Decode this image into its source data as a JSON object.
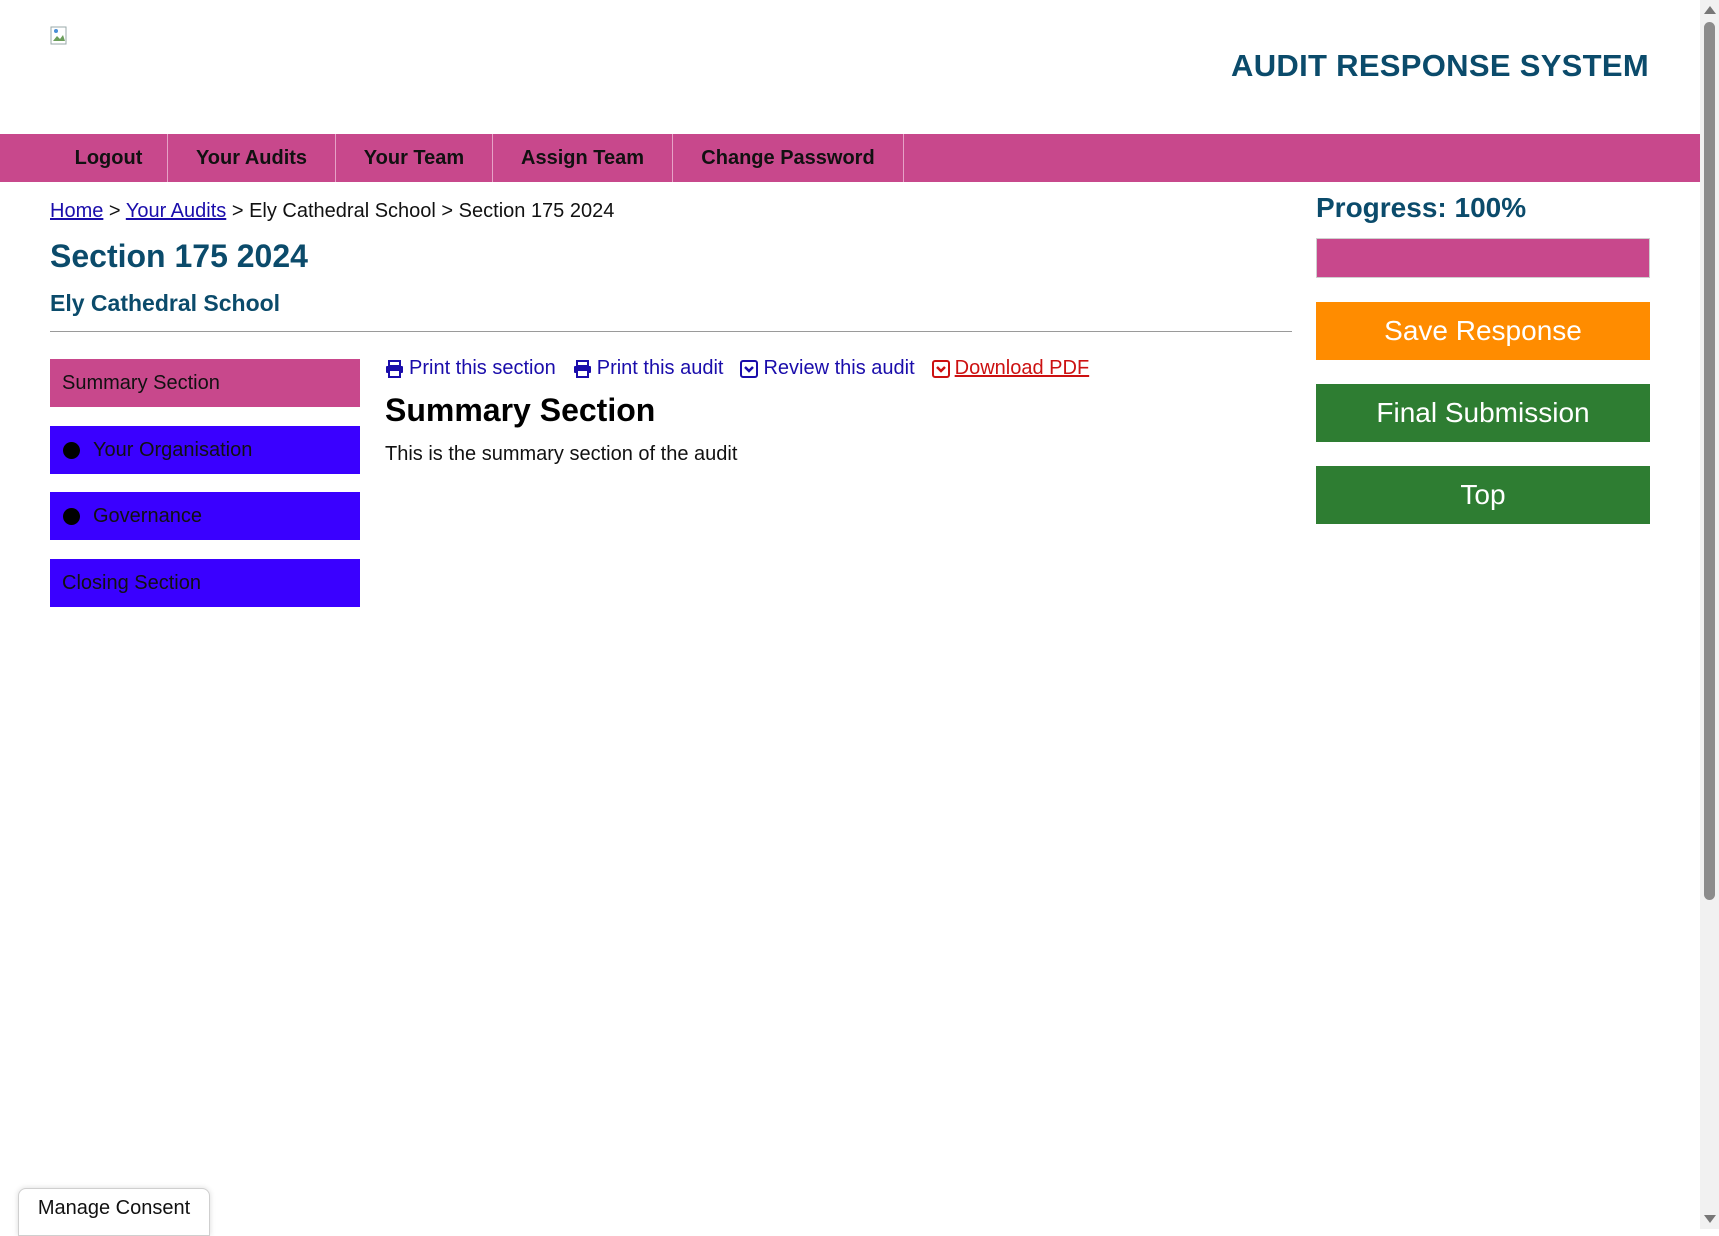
{
  "header": {
    "app_title": "AUDIT RESPONSE SYSTEM",
    "logo_icon": "broken-image-icon"
  },
  "nav": {
    "items": [
      {
        "label": "Logout"
      },
      {
        "label": "Your Audits"
      },
      {
        "label": "Your Team"
      },
      {
        "label": "Assign Team"
      },
      {
        "label": "Change Password"
      }
    ]
  },
  "breadcrumb": {
    "home": "Home",
    "your_audits": "Your Audits",
    "school": "Ely Cathedral School",
    "section": "Section 175 2024",
    "separator": ">"
  },
  "page": {
    "title": "Section 175 2024",
    "subtitle": "Ely Cathedral School"
  },
  "sections": {
    "items": [
      {
        "label": "Summary Section",
        "state": "active"
      },
      {
        "label": "Your Organisation",
        "state": "pending"
      },
      {
        "label": "Governance",
        "state": "pending"
      },
      {
        "label": "Closing Section",
        "state": "pending"
      }
    ]
  },
  "actions": {
    "print_section": "Print this section",
    "print_audit": "Print this audit",
    "review_audit": "Review this audit",
    "download_pdf": "Download PDF"
  },
  "content": {
    "heading": "Summary Section",
    "description": "This is the summary section of the audit"
  },
  "progress": {
    "label": "Progress: 100%",
    "value": 1.0
  },
  "buttons": {
    "save": "Save Response",
    "final": "Final Submission",
    "top": "Top"
  },
  "consent": {
    "label": "Manage Consent"
  },
  "colors": {
    "brand_pink": "#c8488c",
    "title_blue": "#0b4b6b",
    "pending_blue": "#3a00ff",
    "save_orange": "#ff8c00",
    "action_green": "#2e7d32",
    "link_blue": "#1a0dab",
    "pdf_red": "#cc1111"
  }
}
